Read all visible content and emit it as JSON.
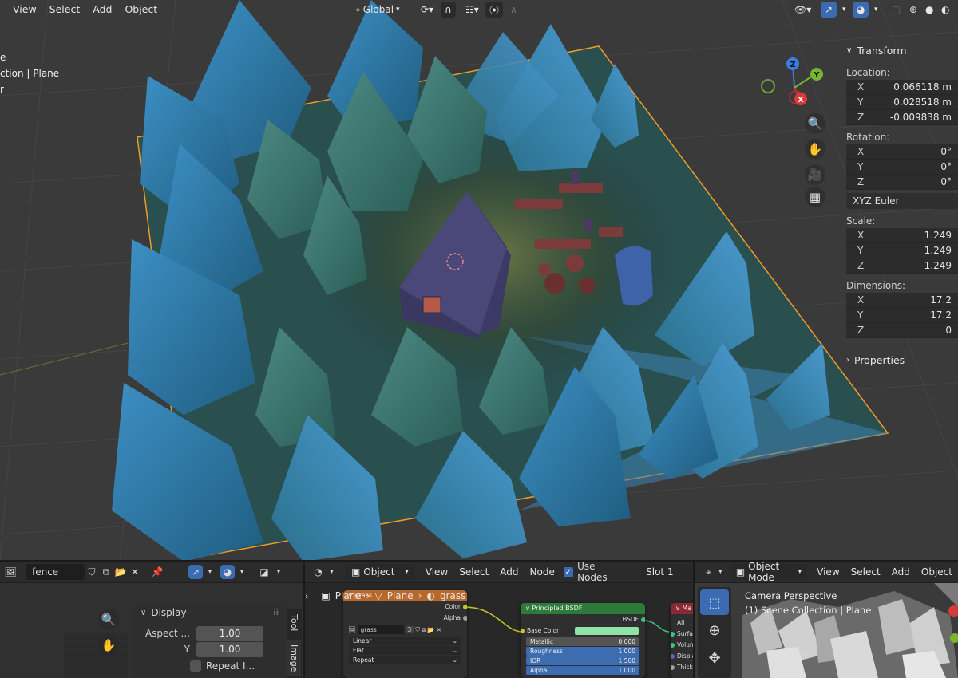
{
  "viewport": {
    "menu": [
      "View",
      "Select",
      "Add",
      "Object"
    ],
    "transform_orientation": "Global",
    "info_lines": [
      "e",
      "ction | Plane",
      "r"
    ],
    "gizmo": {
      "z": "Z",
      "y": "Y",
      "x": "X"
    }
  },
  "npanel": {
    "transform_title": "Transform",
    "location_label": "Location:",
    "location": [
      {
        "axis": "X",
        "value": "0.066118 m"
      },
      {
        "axis": "Y",
        "value": "0.028518 m"
      },
      {
        "axis": "Z",
        "value": "-0.009838 m"
      }
    ],
    "rotation_label": "Rotation:",
    "rotation": [
      {
        "axis": "X",
        "value": "0°"
      },
      {
        "axis": "Y",
        "value": "0°"
      },
      {
        "axis": "Z",
        "value": "0°"
      }
    ],
    "rotation_mode": "XYZ Euler",
    "scale_label": "Scale:",
    "scale": [
      {
        "axis": "X",
        "value": "1.249"
      },
      {
        "axis": "Y",
        "value": "1.249"
      },
      {
        "axis": "Z",
        "value": "1.249"
      }
    ],
    "dimensions_label": "Dimensions:",
    "dimensions": [
      {
        "axis": "X",
        "value": "17.2"
      },
      {
        "axis": "Y",
        "value": "17.2"
      },
      {
        "axis": "Z",
        "value": "0"
      }
    ],
    "properties_title": "Properties"
  },
  "image_editor": {
    "image_name": "fence",
    "display_title": "Display",
    "aspect_label": "Aspect ...",
    "aspect_x": "1.00",
    "y_label": "Y",
    "aspect_y": "1.00",
    "repeat_label": "Repeat I...",
    "side_tabs": [
      "Tool",
      "Image"
    ]
  },
  "node_editor": {
    "object_type": "Object",
    "menu": [
      "View",
      "Select",
      "Add",
      "Node"
    ],
    "use_nodes_label": "Use Nodes",
    "slot": "Slot 1",
    "breadcrumb": [
      "Plane",
      "Plane",
      "grass"
    ],
    "image_node": {
      "title": "grass",
      "outputs": [
        "Color",
        "Alpha"
      ],
      "image_name": "grass",
      "users": "3",
      "interpolation": "Linear",
      "projection": "Flat",
      "extension": "Repeat"
    },
    "bsdf_node": {
      "title": "Principled BSDF",
      "output": "BSDF",
      "base_color_label": "Base Color",
      "fields": [
        {
          "label": "Metallic",
          "value": "0.000"
        },
        {
          "label": "Roughness",
          "value": "1.000"
        },
        {
          "label": "IOR",
          "value": "1.500"
        },
        {
          "label": "Alpha",
          "value": "1.000"
        }
      ]
    },
    "output_node": {
      "title": "Ma",
      "target": "All",
      "inputs": [
        "Surfac",
        "Volum",
        "Displa",
        "Thickn"
      ]
    }
  },
  "camera_editor": {
    "mode": "Object Mode",
    "menu": [
      "View",
      "Select",
      "Add",
      "Object"
    ],
    "view_name": "Camera Perspective",
    "collection": "(1) Scene Collection | Plane"
  },
  "colors": {
    "accent_blue": "#3b6bb3",
    "bsdf_header": "#2e7a3a",
    "image_header": "#b8682a",
    "base_color": "#8fe3a4",
    "field_blue": "#3c6db0",
    "selection_orange": "#f09a2a"
  }
}
